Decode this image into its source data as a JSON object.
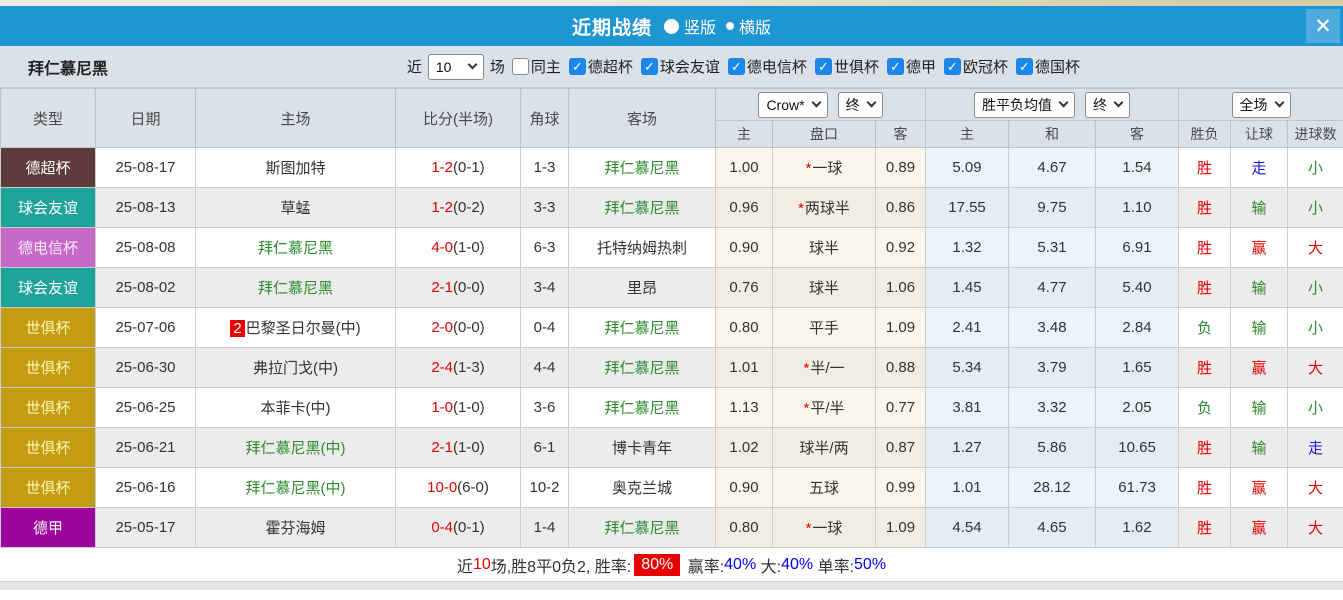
{
  "colors": {
    "header_blue": "#1e96d4",
    "close_btn_blue": "#4fabdd",
    "panel_gray": "#dbe1e8",
    "red": "#e60000",
    "green": "#2e8b2e",
    "blue": "#1414dd",
    "checkbox_blue": "#1c87e8",
    "summary_blue": "#0000ee"
  },
  "titlebar": {
    "title": "近期战绩",
    "radios": [
      {
        "label": "竖版",
        "selected": true
      },
      {
        "label": "横版",
        "selected": false
      }
    ],
    "close_glyph": "✕"
  },
  "filter": {
    "team": "拜仁慕尼黑",
    "near_label": "近",
    "count_value": "10",
    "games_label": "场",
    "same_home": {
      "label": "同主",
      "checked": false
    },
    "leagues": [
      {
        "label": "德超杯",
        "checked": true
      },
      {
        "label": "球会友谊",
        "checked": true
      },
      {
        "label": "德电信杯",
        "checked": true
      },
      {
        "label": "世俱杯",
        "checked": true
      },
      {
        "label": "德甲",
        "checked": true
      },
      {
        "label": "欧冠杯",
        "checked": true
      },
      {
        "label": "德国杯",
        "checked": true
      }
    ]
  },
  "table": {
    "main_headers": [
      "类型",
      "日期",
      "主场",
      "比分(半场)",
      "角球",
      "客场"
    ],
    "group1_select": "Crow*",
    "group1_final_select": "终",
    "group2_select": "胜平负均值",
    "group2_final_select": "终",
    "group3_select": "全场",
    "sub_headers": [
      "主",
      "盘口",
      "客",
      "主",
      "和",
      "客",
      "胜负",
      "让球",
      "进球数"
    ],
    "rows": [
      {
        "type": {
          "label": "德超杯",
          "bg": "#5e3a3a",
          "fg": "#ffffff"
        },
        "date": "25-08-17",
        "home": {
          "badge": "",
          "text": "斯图加特",
          "green": false
        },
        "score": {
          "ft": "1-2",
          "ht": "(0-1)"
        },
        "corners": "1-3",
        "away": {
          "text": "拜仁慕尼黑",
          "green": true
        },
        "asian": {
          "home": "1.00",
          "star": true,
          "line": "一球",
          "away": "0.89"
        },
        "avg": {
          "win": "5.09",
          "draw": "4.67",
          "lose": "1.54"
        },
        "result": {
          "text": "胜",
          "c": "red"
        },
        "handicap_result": {
          "text": "走",
          "c": "blue"
        },
        "goals": {
          "text": "小",
          "c": "green"
        }
      },
      {
        "type": {
          "label": "球会友谊",
          "bg": "#1fa29a",
          "fg": "#ffffff"
        },
        "date": "25-08-13",
        "home": {
          "badge": "",
          "text": "草蜢",
          "green": false
        },
        "score": {
          "ft": "1-2",
          "ht": "(0-2)"
        },
        "corners": "3-3",
        "away": {
          "text": "拜仁慕尼黑",
          "green": true
        },
        "asian": {
          "home": "0.96",
          "star": true,
          "line": "两球半",
          "away": "0.86"
        },
        "avg": {
          "win": "17.55",
          "draw": "9.75",
          "lose": "1.10"
        },
        "result": {
          "text": "胜",
          "c": "red"
        },
        "handicap_result": {
          "text": "输",
          "c": "green"
        },
        "goals": {
          "text": "小",
          "c": "green"
        }
      },
      {
        "type": {
          "label": "德电信杯",
          "bg": "#c869c8",
          "fg": "#ffeaff"
        },
        "date": "25-08-08",
        "home": {
          "badge": "",
          "text": "拜仁慕尼黑",
          "green": true
        },
        "score": {
          "ft": "4-0",
          "ht": "(1-0)"
        },
        "corners": "6-3",
        "away": {
          "text": "托特纳姆热刺",
          "green": false
        },
        "asian": {
          "home": "0.90",
          "star": false,
          "line": "球半",
          "away": "0.92"
        },
        "avg": {
          "win": "1.32",
          "draw": "5.31",
          "lose": "6.91"
        },
        "result": {
          "text": "胜",
          "c": "red"
        },
        "handicap_result": {
          "text": "赢",
          "c": "red"
        },
        "goals": {
          "text": "大",
          "c": "red"
        }
      },
      {
        "type": {
          "label": "球会友谊",
          "bg": "#1fa29a",
          "fg": "#ffffff"
        },
        "date": "25-08-02",
        "home": {
          "badge": "",
          "text": "拜仁慕尼黑",
          "green": true
        },
        "score": {
          "ft": "2-1",
          "ht": "(0-0)"
        },
        "corners": "3-4",
        "away": {
          "text": "里昂",
          "green": false
        },
        "asian": {
          "home": "0.76",
          "star": false,
          "line": "球半",
          "away": "1.06"
        },
        "avg": {
          "win": "1.45",
          "draw": "4.77",
          "lose": "5.40"
        },
        "result": {
          "text": "胜",
          "c": "red"
        },
        "handicap_result": {
          "text": "输",
          "c": "green"
        },
        "goals": {
          "text": "小",
          "c": "green"
        }
      },
      {
        "type": {
          "label": "世俱杯",
          "bg": "#c49c10",
          "fg": "#fdf3b5"
        },
        "date": "25-07-06",
        "home": {
          "badge": "2",
          "text": "巴黎圣日尔曼(中)",
          "green": false
        },
        "score": {
          "ft": "2-0",
          "ht": "(0-0)"
        },
        "corners": "0-4",
        "away": {
          "text": "拜仁慕尼黑",
          "green": true
        },
        "asian": {
          "home": "0.80",
          "star": false,
          "line": "平手",
          "away": "1.09"
        },
        "avg": {
          "win": "2.41",
          "draw": "3.48",
          "lose": "2.84"
        },
        "result": {
          "text": "负",
          "c": "green"
        },
        "handicap_result": {
          "text": "输",
          "c": "green"
        },
        "goals": {
          "text": "小",
          "c": "green"
        }
      },
      {
        "type": {
          "label": "世俱杯",
          "bg": "#c49c10",
          "fg": "#fdf3b5"
        },
        "date": "25-06-30",
        "home": {
          "badge": "",
          "text": "弗拉门戈(中)",
          "green": false
        },
        "score": {
          "ft": "2-4",
          "ht": "(1-3)"
        },
        "corners": "4-4",
        "away": {
          "text": "拜仁慕尼黑",
          "green": true
        },
        "asian": {
          "home": "1.01",
          "star": true,
          "line": "半/一",
          "away": "0.88"
        },
        "avg": {
          "win": "5.34",
          "draw": "3.79",
          "lose": "1.65"
        },
        "result": {
          "text": "胜",
          "c": "red"
        },
        "handicap_result": {
          "text": "赢",
          "c": "red"
        },
        "goals": {
          "text": "大",
          "c": "red"
        }
      },
      {
        "type": {
          "label": "世俱杯",
          "bg": "#c49c10",
          "fg": "#fdf3b5"
        },
        "date": "25-06-25",
        "home": {
          "badge": "",
          "text": "本菲卡(中)",
          "green": false
        },
        "score": {
          "ft": "1-0",
          "ht": "(1-0)"
        },
        "corners": "3-6",
        "away": {
          "text": "拜仁慕尼黑",
          "green": true
        },
        "asian": {
          "home": "1.13",
          "star": true,
          "line": "平/半",
          "away": "0.77"
        },
        "avg": {
          "win": "3.81",
          "draw": "3.32",
          "lose": "2.05"
        },
        "result": {
          "text": "负",
          "c": "green"
        },
        "handicap_result": {
          "text": "输",
          "c": "green"
        },
        "goals": {
          "text": "小",
          "c": "green"
        }
      },
      {
        "type": {
          "label": "世俱杯",
          "bg": "#c49c10",
          "fg": "#fdf3b5"
        },
        "date": "25-06-21",
        "home": {
          "badge": "",
          "text": "拜仁慕尼黑(中)",
          "green": true
        },
        "score": {
          "ft": "2-1",
          "ht": "(1-0)"
        },
        "corners": "6-1",
        "away": {
          "text": "博卡青年",
          "green": false
        },
        "asian": {
          "home": "1.02",
          "star": false,
          "line": "球半/两",
          "away": "0.87"
        },
        "avg": {
          "win": "1.27",
          "draw": "5.86",
          "lose": "10.65"
        },
        "result": {
          "text": "胜",
          "c": "red"
        },
        "handicap_result": {
          "text": "输",
          "c": "green"
        },
        "goals": {
          "text": "走",
          "c": "blue"
        }
      },
      {
        "type": {
          "label": "世俱杯",
          "bg": "#c49c10",
          "fg": "#fdf3b5"
        },
        "date": "25-06-16",
        "home": {
          "badge": "",
          "text": "拜仁慕尼黑(中)",
          "green": true
        },
        "score": {
          "ft": "10-0",
          "ht": "(6-0)"
        },
        "corners": "10-2",
        "away": {
          "text": "奥克兰城",
          "green": false
        },
        "asian": {
          "home": "0.90",
          "star": false,
          "line": "五球",
          "away": "0.99"
        },
        "avg": {
          "win": "1.01",
          "draw": "28.12",
          "lose": "61.73"
        },
        "result": {
          "text": "胜",
          "c": "red"
        },
        "handicap_result": {
          "text": "赢",
          "c": "red"
        },
        "goals": {
          "text": "大",
          "c": "red"
        }
      },
      {
        "type": {
          "label": "德甲",
          "bg": "#9c029c",
          "fg": "#ffffff"
        },
        "date": "25-05-17",
        "home": {
          "badge": "",
          "text": "霍芬海姆",
          "green": false
        },
        "score": {
          "ft": "0-4",
          "ht": "(0-1)"
        },
        "corners": "1-4",
        "away": {
          "text": "拜仁慕尼黑",
          "green": true
        },
        "asian": {
          "home": "0.80",
          "star": true,
          "line": "一球",
          "away": "1.09"
        },
        "avg": {
          "win": "4.54",
          "draw": "4.65",
          "lose": "1.62"
        },
        "result": {
          "text": "胜",
          "c": "red"
        },
        "handicap_result": {
          "text": "赢",
          "c": "red"
        },
        "goals": {
          "text": "大",
          "c": "red"
        }
      }
    ]
  },
  "summary": {
    "segments": [
      {
        "t": "近",
        "s": "plain"
      },
      {
        "t": "10",
        "s": "red"
      },
      {
        "t": "场,胜8平0负2, 胜率:",
        "s": "plain"
      },
      {
        "t": "80%",
        "s": "badge"
      },
      {
        "t": " 赢率:",
        "s": "plain"
      },
      {
        "t": "40%",
        "s": "blue"
      },
      {
        "t": " 大:",
        "s": "plain"
      },
      {
        "t": "40%",
        "s": "blue"
      },
      {
        "t": " 单率:",
        "s": "plain"
      },
      {
        "t": "50%",
        "s": "blue"
      }
    ]
  }
}
